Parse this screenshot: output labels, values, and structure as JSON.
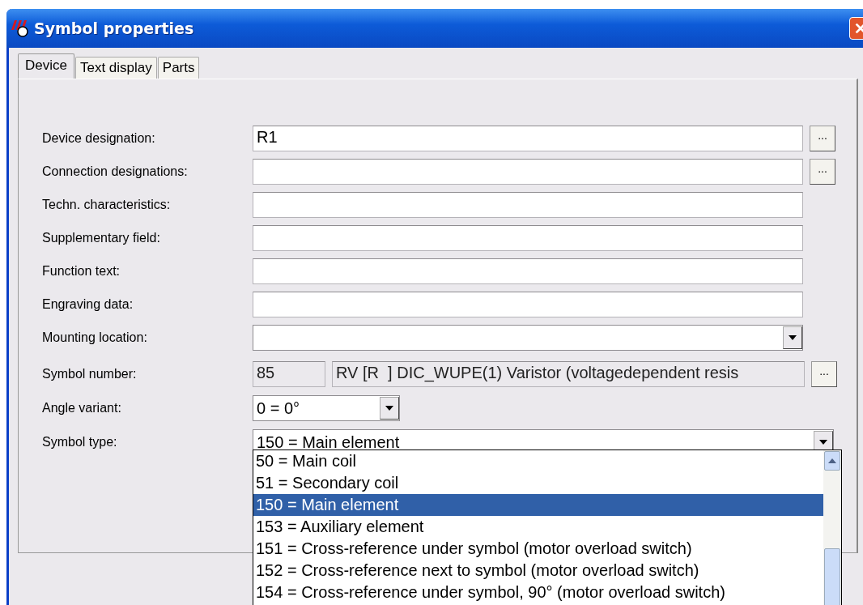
{
  "window": {
    "title": "Symbol properties"
  },
  "tabs": [
    {
      "label": "Device",
      "selected": true
    },
    {
      "label": "Text display",
      "selected": false
    },
    {
      "label": "Parts",
      "selected": false
    }
  ],
  "fields": [
    {
      "kind": "text",
      "label": "Device designation:",
      "value": "R1",
      "browse": "..."
    },
    {
      "kind": "text",
      "label": "Connection designations:",
      "browse": "..."
    },
    {
      "kind": "text",
      "label": "Techn. characteristics:"
    },
    {
      "kind": "text",
      "label": "Supplementary field:"
    },
    {
      "kind": "text",
      "label": "Function text:"
    },
    {
      "kind": "text",
      "label": "Engraving data:"
    },
    {
      "kind": "combo",
      "label": "Mounting location:"
    },
    {
      "kind": "symbol",
      "label": "Symbol number:",
      "value": "85",
      "description": "RV [R  ] DIC_WUPE(1) Varistor (voltagedependent resis",
      "browse": "..."
    },
    {
      "kind": "short-combo",
      "label": "Angle variant:",
      "value": "0 = 0°"
    },
    {
      "kind": "combo",
      "label": "Symbol type:",
      "value": "150 = Main element"
    }
  ],
  "dropdown": {
    "items": [
      {
        "label": "50 = Main coil",
        "selected": false
      },
      {
        "label": "51 = Secondary coil",
        "selected": false
      },
      {
        "label": "150 = Main element",
        "selected": true
      },
      {
        "label": "153 = Auxiliary element",
        "selected": false
      },
      {
        "label": "151 = Cross-reference under symbol (motor overload switch)",
        "selected": false
      },
      {
        "label": "152 = Cross-reference next to symbol (motor overload switch)",
        "selected": false
      },
      {
        "label": "154 = Cross-reference under symbol, 90° (motor overload switch)",
        "selected": false
      }
    ]
  }
}
